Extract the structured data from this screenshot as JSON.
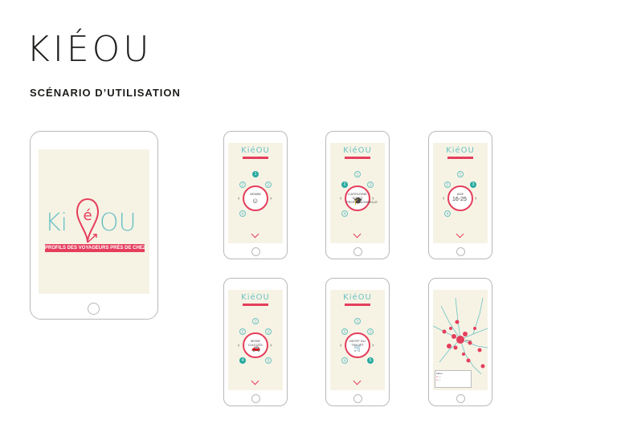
{
  "header": {
    "brand": "KIÉOU",
    "subtitle": "SCÉNARIO D’UTILISATION"
  },
  "hero": {
    "logo_left": "Ki",
    "logo_pin": "é",
    "logo_right": "OU",
    "tagline": "PROFILS DES VOYAGEURS PRÈS DE CHEZ VOUS"
  },
  "mini_logo": "KiéOU",
  "screens": [
    {
      "label": "GENRE",
      "icon": "face-icon",
      "picture": "☺",
      "dots": [
        "1",
        "2",
        "3",
        "4"
      ],
      "active": 0
    },
    {
      "label": "CATÉGORIE SOCIO PROFESSIONNELLE",
      "icon": "graduation-cap-icon",
      "picture": "🎓",
      "dots": [
        "1",
        "2",
        "3",
        "4"
      ],
      "active": 1
    },
    {
      "label": "AGE",
      "icon": "age-icon",
      "picture": "16-25",
      "dots": [
        "1",
        "2",
        "3",
        "4"
      ],
      "active": 2
    },
    {
      "label": "MODE D'ACCÈS",
      "icon": "car-icon",
      "picture": "🚗",
      "dots": [
        "1",
        "2",
        "3",
        "4",
        "5"
      ],
      "active": 3
    },
    {
      "label": "MOTIF DU TRAJET",
      "icon": "cart-icon",
      "picture": "🛒",
      "dots": [
        "1",
        "2",
        "3",
        "4",
        "5"
      ],
      "active": 4
    }
  ],
  "map": {
    "label": "Kiéou",
    "legend_title": "Kiéou",
    "legend_items": [
      "—",
      "—"
    ]
  },
  "colors": {
    "teal": "#6cc2c4",
    "dark_teal": "#28aaa0",
    "pink": "#e53e5c",
    "screen_bg": "#f6f3e5"
  }
}
